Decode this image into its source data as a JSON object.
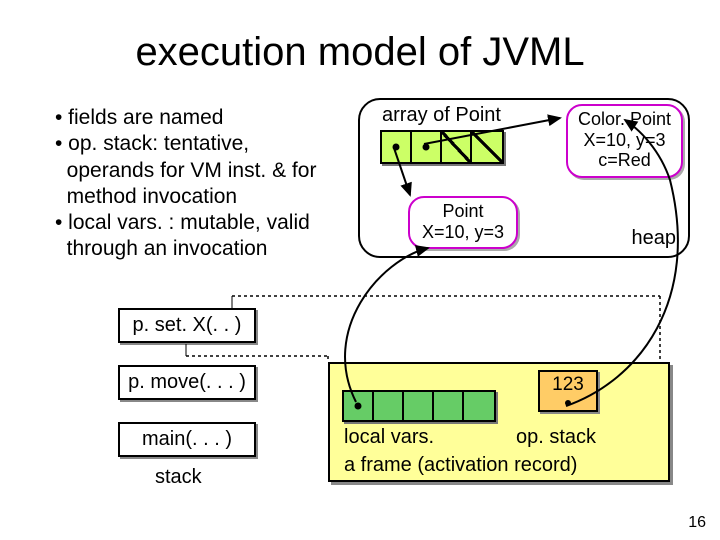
{
  "title": "execution model of JVML",
  "bullets": {
    "b1": "• fields are named",
    "b2": "• op. stack: tentative,",
    "b2b": "  operands for VM inst. & for",
    "b2c": "  method invocation",
    "b3": "• local vars. : mutable, valid",
    "b3b": "  through an invocation"
  },
  "heap": {
    "array_label": "array of Point",
    "heap_label": "heap",
    "point": {
      "line1": "Point",
      "line2": "X=10, y=3"
    },
    "colorpoint": {
      "line1": "Color. Point",
      "line2": "X=10, y=3",
      "line3": "c=Red"
    }
  },
  "stack": {
    "item1": "p. set. X(. . )",
    "item2": "p. move(. . . )",
    "item3": "main(. . . )",
    "label": "stack"
  },
  "frame": {
    "opstack_value": "123",
    "locals_label": "local vars.",
    "opstack_label": "op. stack",
    "frame_label": "a frame (activation record)"
  },
  "page_number": "16"
}
